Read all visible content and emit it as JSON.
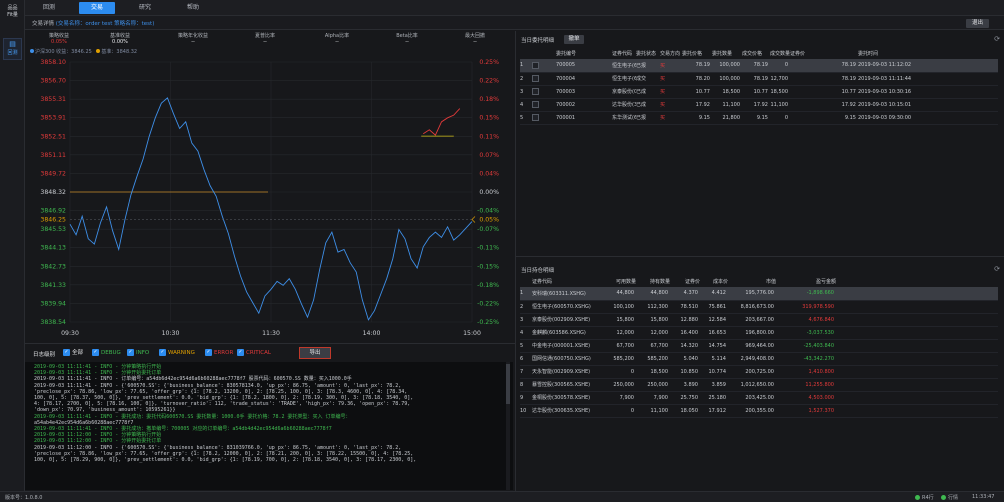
{
  "sidebar": {
    "logo_line1": "品品",
    "logo_line2": "Fit量",
    "nav_label": "回测"
  },
  "tabs": [
    "回测",
    "交易",
    "研究",
    "帮助"
  ],
  "info": {
    "prefix": "交易详情",
    "strategy_label": "(交易名称：order test",
    "strategy_name_label": "策略名称：test)",
    "exit_label": "退出"
  },
  "stats": [
    {
      "label": "策略收益",
      "value": "0.05%",
      "color": "red"
    },
    {
      "label": "基准收益",
      "value": "0.00%",
      "color": "white"
    },
    {
      "label": "策略年化收益",
      "value": "--",
      "color": "white"
    },
    {
      "label": "夏普比率",
      "value": "--",
      "color": "white"
    },
    {
      "label": "Alpha比率",
      "value": "--",
      "color": "white"
    },
    {
      "label": "Beta比率",
      "value": "--",
      "color": "white"
    },
    {
      "label": "最大回撤",
      "value": "--",
      "color": "white"
    }
  ],
  "legend": {
    "strategy": "沪深300 收益：3846.25",
    "benchmark": "基准：3848.32"
  },
  "chart_data": {
    "type": "line",
    "y_left_ticks": [
      "3858.10",
      "3856.70",
      "3855.31",
      "3853.91",
      "3852.51",
      "3851.11",
      "3849.72",
      "3848.32",
      "3846.92",
      "3845.53",
      "3844.13",
      "3842.73",
      "3841.33",
      "3839.94",
      "3838.54"
    ],
    "y_left_current": "3846.25",
    "y_right_ticks": [
      "0.25%",
      "0.22%",
      "0.18%",
      "0.15%",
      "0.11%",
      "0.07%",
      "0.04%",
      "0.00%",
      "-0.04%",
      "-0.07%",
      "-0.11%",
      "-0.15%",
      "-0.18%",
      "-0.22%",
      "-0.25%"
    ],
    "y_right_current": "0.05%",
    "x_ticks": [
      "09:30",
      "10:30",
      "11:30",
      "14:00",
      "15:00"
    ],
    "baseline_value": 3848.32,
    "ylim": [
      3838.54,
      3858.1
    ],
    "series": [
      {
        "color": "#3e8fe8",
        "points": [
          [
            0,
            3845.9
          ],
          [
            1,
            3845.1
          ],
          [
            2,
            3846.5
          ],
          [
            3,
            3844.8
          ],
          [
            4,
            3844.4
          ],
          [
            5,
            3846.0
          ],
          [
            6,
            3847.2
          ],
          [
            7,
            3845.4
          ],
          [
            8,
            3844.0
          ],
          [
            9,
            3846.2
          ],
          [
            10,
            3848.1
          ],
          [
            11,
            3849.5
          ],
          [
            12,
            3850.8
          ],
          [
            13,
            3852.5
          ],
          [
            14,
            3853.9
          ],
          [
            15,
            3855.0
          ],
          [
            16,
            3855.4
          ],
          [
            17,
            3854.2
          ],
          [
            18,
            3853.1
          ],
          [
            19,
            3853.6
          ],
          [
            20,
            3852.0
          ],
          [
            21,
            3851.4
          ],
          [
            22,
            3850.0
          ],
          [
            23,
            3848.8
          ],
          [
            24,
            3848.0
          ],
          [
            25,
            3846.5
          ],
          [
            26,
            3845.2
          ],
          [
            27,
            3843.5
          ],
          [
            28,
            3842.0
          ],
          [
            29,
            3840.8
          ],
          [
            30,
            3840.0
          ],
          [
            31,
            3839.2
          ],
          [
            32,
            3840.5
          ],
          [
            33,
            3841.0
          ],
          [
            34,
            3841.6
          ],
          [
            35,
            3841.3
          ],
          [
            36,
            3841.8
          ],
          [
            37,
            3841.0
          ],
          [
            38,
            3839.9
          ],
          [
            39,
            3838.9
          ],
          [
            40,
            3840.2
          ],
          [
            41,
            3842.5
          ],
          [
            42,
            3844.5
          ],
          [
            43,
            3845.3
          ],
          [
            44,
            3843.8
          ],
          [
            45,
            3844.0
          ],
          [
            46,
            3843.0
          ],
          [
            47,
            3842.3
          ],
          [
            48,
            3840.2
          ],
          [
            49,
            3838.7
          ],
          [
            50,
            3839.4
          ],
          [
            51,
            3840.6
          ],
          [
            52,
            3841.8
          ],
          [
            53,
            3843.3
          ],
          [
            54,
            3845.5
          ],
          [
            55,
            3844.8
          ],
          [
            56,
            3843.3
          ],
          [
            57,
            3842.6
          ],
          [
            58,
            3844.2
          ],
          [
            59,
            3844.9
          ],
          [
            60,
            3845.3
          ],
          [
            61,
            3844.9
          ],
          [
            62,
            3845.7
          ],
          [
            63,
            3844.7
          ],
          [
            64,
            3845.1
          ],
          [
            65,
            3845.6
          ],
          [
            66,
            3846.1
          ]
        ]
      },
      {
        "color": "#e23a3a",
        "points": [
          [
            58,
            3852.7
          ],
          [
            59,
            3853.0
          ],
          [
            60,
            3852.6
          ],
          [
            61,
            3853.6
          ],
          [
            62,
            3853.9
          ],
          [
            63,
            3854.1
          ],
          [
            64,
            3854.6
          ]
        ]
      }
    ]
  },
  "log": {
    "title": "日志级别",
    "levels": [
      {
        "name": "全部",
        "color": "#e6e7ea"
      },
      {
        "name": "DEBUG",
        "color": "#3fb950"
      },
      {
        "name": "INFO",
        "color": "#3fb950"
      },
      {
        "name": "WARNING",
        "color": "#e0a000"
      },
      {
        "name": "ERROR",
        "color": "#e23a3a"
      },
      {
        "name": "CRITICAL",
        "color": "#e23a3a"
      }
    ],
    "export_label": "导出",
    "lines": [
      "2019-09-03 11:11:41 - INFO - 分钟策略执行开始",
      "2019-09-03 11:11:41 - INFO - 分钟开始委托订单",
      "2019-09-03 11:11:41 - INFO - 订单编号：a54db6d42ec954d6a6b60288aec7778f7 股票代码：600570.SS 数量：买入1000.0手",
      "2019-09-03 11:11:41 - INFO - {'600570.SS': {'business_balance': 830578134.0, 'up_px': 86.75, 'amount': 0, 'last_px': 78.2,",
      "'preclose_px': 78.86, 'low_px': 77.65, 'offer_grp': {1: [78.2, 13200, 0], 2: [78.25, 100, 0], 3: [78.3, 4600, 0], 4: [78.34,",
      "100, 0], 5: [78.37, 500, 0]}, 'prev_settlement': 0.0, 'bid_grp': {1: [78.2, 1800, 0], 2: [78.19, 300, 0], 3: [78.18, 3540, 0],",
      "4: [78.17, 2700, 0], 5: [78.16, 100, 0]}, 'turnover_ratio': 112, 'trade_status': 'TRADE', 'high_px': 79.36, 'open_px': 78.79,",
      "'down_px': 70.97, 'business_amount': 10595261}}",
      "2019-09-03 11:11:41 - INFO - 委托成功：委托代码600570.SS 委托数量：1000.0手 委托价格：78.2 委托类型：买入 订单编号：",
      "a54ab4e42ec954d6a6b60288aec7778f7",
      "2019-09-03 11:11:41 - INFO - 委托成功：撤单编号：700005 对应的订单编号：a54db4d42ec954d6a6b60288aec7778f7",
      "2019-09-03 11:12:00 - INFO - 分钟策略执行开始",
      "2019-09-03 11:12:00 - INFO - 分钟开始委托订单",
      "2019-09-03 11:12:00 - INFO - {'600570.SS': {'business_balance': 831039766.0, 'up_px': 86.75, 'amount': 0, 'last_px': 78.2,",
      "'preclose_px': 78.86, 'low_px': 77.65, 'offer_grp': {1: [78.2, 12000, 0], 2: [78.21, 200, 0], 3: [78.22, 15500, 0], 4: [78.25,",
      "100, 0], 5: [78.29, 900, 0]}, 'prev_settlement': 0.0, 'bid_grp': {1: [78.19, 700, 0], 2: [78.18, 3540, 0], 3: [78.17, 2300, 0],"
    ]
  },
  "orders": {
    "title": "当日委托明细",
    "cancel_label": "撤单",
    "columns": [
      "委托编号",
      "证券代码",
      "委托状态",
      "交易方向",
      "委托价格",
      "委托数量",
      "成交价格",
      "成交数量",
      "证券价",
      "委托时间"
    ],
    "rows": [
      {
        "id": "700005",
        "code": "恒生电子(600570.XSHG)",
        "status": "已报",
        "dir": "买",
        "price": "78.19",
        "qty": "100,000",
        "deal_price": "78.19",
        "deal_qty": "0",
        "sec_price": "78.19",
        "time": "2019-09-03 11:12:02",
        "selected": true
      },
      {
        "id": "700004",
        "code": "恒生电子(600570.XSHG)",
        "status": "成交",
        "dir": "买",
        "price": "78.20",
        "qty": "100,000",
        "deal_price": "78.19",
        "deal_qty": "12,700",
        "sec_price": "78.19",
        "time": "2019-09-03 11:11:44",
        "selected": false
      },
      {
        "id": "700003",
        "code": "京泰股份(002909.XSHE)",
        "status": "已成",
        "dir": "买",
        "price": "10.77",
        "qty": "18,500",
        "deal_price": "10.77",
        "deal_qty": "18,500",
        "sec_price": "10.77",
        "time": "2019-09-03 10:30:16",
        "selected": false
      },
      {
        "id": "700002",
        "code": "达华股份(300635.XSHE)",
        "status": "已成",
        "dir": "买",
        "price": "17.92",
        "qty": "11,100",
        "deal_price": "17.92",
        "deal_qty": "11,100",
        "sec_price": "17.92",
        "time": "2019-09-03 10:15:01",
        "selected": false
      },
      {
        "id": "700001",
        "code": "东华测试(600734.XSHG)",
        "status": "已报",
        "dir": "买",
        "price": "9.15",
        "qty": "21,800",
        "deal_price": "9.15",
        "deal_qty": "0",
        "sec_price": "9.15",
        "time": "2019-09-03 09:30:00",
        "selected": false
      }
    ]
  },
  "positions": {
    "title": "当日持仓明细",
    "columns": [
      "证券代码",
      "可用数量",
      "持有数量",
      "证券价",
      "成本价",
      "市值",
      "盈亏金额"
    ],
    "rows": [
      {
        "code": "安科瑞(603311.XSHG)",
        "avail": "44,800",
        "hold": "44,800",
        "price": "4.370",
        "cost": "4.412",
        "value": "195,776.00",
        "pnl": "-1,898.660",
        "pnl_color": "green",
        "selected": true
      },
      {
        "code": "恒生电子(600570.XSHG)",
        "avail": "100,100",
        "hold": "112,300",
        "price": "78.510",
        "cost": "75.861",
        "value": "8,816,673.00",
        "pnl": "319,978.590",
        "pnl_color": "red",
        "selected": false
      },
      {
        "code": "京泰股份(002909.XSHE)",
        "avail": "15,800",
        "hold": "15,800",
        "price": "12.880",
        "cost": "12.584",
        "value": "203,667.00",
        "pnl": "4,676.840",
        "pnl_color": "red",
        "selected": false
      },
      {
        "code": "金麒麟(603586.XSHG)",
        "avail": "12,000",
        "hold": "12,000",
        "price": "16.400",
        "cost": "16.653",
        "value": "196,800.00",
        "pnl": "-3,037.530",
        "pnl_color": "green",
        "selected": false
      },
      {
        "code": "中金电子(000001.XSHE)",
        "avail": "67,700",
        "hold": "67,700",
        "price": "14.320",
        "cost": "14.754",
        "value": "969,464.00",
        "pnl": "-25,403.840",
        "pnl_color": "green",
        "selected": false
      },
      {
        "code": "国网信通(600750.XSHG)",
        "avail": "585,200",
        "hold": "585,200",
        "price": "5.040",
        "cost": "5.114",
        "value": "2,949,408.00",
        "pnl": "-43,342.270",
        "pnl_color": "green",
        "selected": false
      },
      {
        "code": "天永智能(002909.XSHE)",
        "avail": "0",
        "hold": "18,500",
        "price": "10.850",
        "cost": "10.774",
        "value": "200,725.00",
        "pnl": "1,410.800",
        "pnl_color": "red",
        "selected": false
      },
      {
        "code": "暴雪控股(300565.XSHE)",
        "avail": "250,000",
        "hold": "250,000",
        "price": "3.890",
        "cost": "3.859",
        "value": "1,012,650.00",
        "pnl": "11,255.800",
        "pnl_color": "red",
        "selected": false
      },
      {
        "code": "金桐股份(300578.XSHE)",
        "avail": "7,900",
        "hold": "7,900",
        "price": "25.750",
        "cost": "25.180",
        "value": "203,425.00",
        "pnl": "4,503.000",
        "pnl_color": "red",
        "selected": false
      },
      {
        "code": "达华股份(300635.XSHE)",
        "avail": "0",
        "hold": "11,100",
        "price": "18.050",
        "cost": "17.912",
        "value": "200,355.00",
        "pnl": "1,527.370",
        "pnl_color": "red",
        "selected": false
      }
    ]
  },
  "footer": {
    "version": "版本号：1.0.8.0",
    "status1": "R4行",
    "status2": "行情",
    "time": "11:33:47"
  }
}
